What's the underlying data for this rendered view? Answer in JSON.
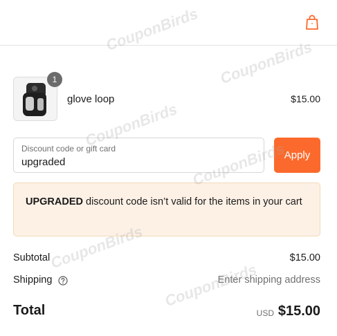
{
  "header": {
    "cart_icon": "shopping-bag-icon",
    "accent_color": "#fb6a2c"
  },
  "cart": {
    "items": [
      {
        "name": "glove loop",
        "price": "$15.00",
        "quantity": "1",
        "thumbnail": "product-photo"
      }
    ]
  },
  "discount": {
    "label": "Discount code or gift card",
    "value": "upgraded",
    "apply_label": "Apply",
    "apply_color": "#fb6a2c"
  },
  "error": {
    "code": "UPGRADED",
    "message": " discount code isn’t valid for the items in your cart"
  },
  "summary": {
    "subtotal_label": "Subtotal",
    "subtotal_value": "$15.00",
    "shipping_label": "Shipping",
    "shipping_help_icon": "question-circle-icon",
    "shipping_value": "Enter shipping address",
    "total_label": "Total",
    "currency": "USD",
    "total_value": "$15.00"
  },
  "watermark": {
    "text": "CouponBirds"
  }
}
